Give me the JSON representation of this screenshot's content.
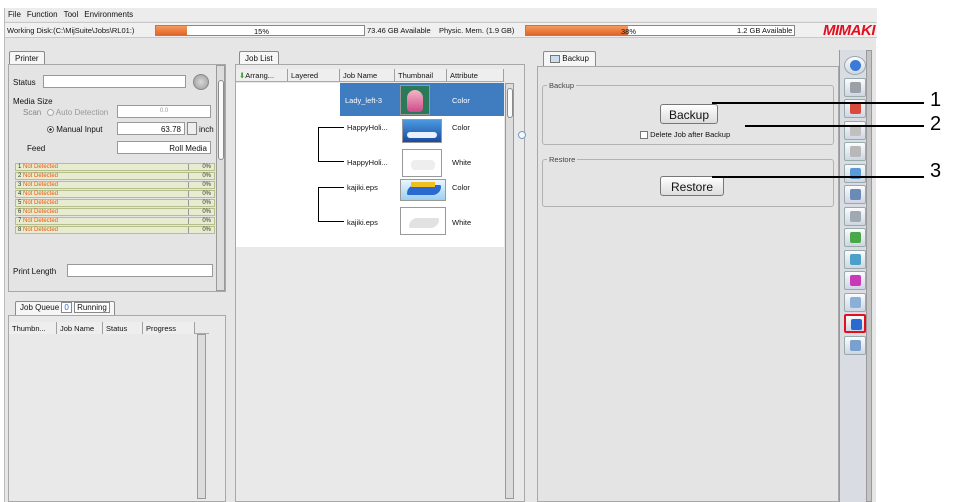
{
  "menu": [
    "File",
    "Function",
    "Tool",
    "Environments"
  ],
  "status": {
    "working_disk_label": "Working Disk:(C:\\MijSuite\\Jobs\\RL01:)",
    "disk_percent_text": "15%",
    "disk_fraction": 0.15,
    "disk_available": "73.46 GB Available",
    "mem_label": "Physic. Mem. (1.9 GB)",
    "mem_percent_text": "38%",
    "mem_fraction": 0.38,
    "mem_available": "1.2 GB Available",
    "logo": "MIMAKI",
    "accent_color": "#e0642a"
  },
  "printer": {
    "tab": "Printer",
    "status_label": "Status",
    "status_value": "",
    "media_size_label": "Media Size",
    "scan_label": "Scan",
    "auto_detection": "Auto Detection",
    "auto_value": "0.0",
    "manual_input": "Manual Input",
    "manual_value": "63.78",
    "unit": "inch",
    "feed_label": "Feed",
    "feed_value": "Roll Media",
    "print_length_label": "Print Length",
    "inks": [
      {
        "num": "1",
        "status": "Not Detected",
        "pct": "0%"
      },
      {
        "num": "2",
        "status": "Not Detected",
        "pct": "0%"
      },
      {
        "num": "3",
        "status": "Not Detected",
        "pct": "0%"
      },
      {
        "num": "4",
        "status": "Not Detected",
        "pct": "0%"
      },
      {
        "num": "5",
        "status": "Not Detected",
        "pct": "0%"
      },
      {
        "num": "6",
        "status": "Not Detected",
        "pct": "0%"
      },
      {
        "num": "7",
        "status": "Not Detected",
        "pct": "0%"
      },
      {
        "num": "8",
        "status": "Not Detected",
        "pct": "0%"
      }
    ]
  },
  "queue": {
    "tab_label": "Job Queue",
    "count": "0",
    "running_label": "Running",
    "columns": [
      "Thumbn...",
      "Job Name",
      "Status",
      "Progress"
    ]
  },
  "joblist": {
    "tab": "Job List",
    "columns": [
      "Arrang...",
      "Layered",
      "Job Name",
      "Thumbnail",
      "Attribute"
    ],
    "rows": [
      {
        "name": "Lady_left-3",
        "attr": "Color",
        "selected": true
      },
      {
        "name": "HappyHoli...",
        "attr": "Color"
      },
      {
        "name": "HappyHoli...",
        "attr": "White"
      },
      {
        "name": "kajiki.eps",
        "attr": "Color"
      },
      {
        "name": "kajiki.eps",
        "attr": "White"
      }
    ]
  },
  "backup": {
    "tab": "Backup",
    "group_backup": "Backup",
    "backup_button": "Backup",
    "delete_checkbox": "Delete Job after Backup",
    "group_restore": "Restore",
    "restore_button": "Restore"
  },
  "callouts": [
    "1",
    "2",
    "3"
  ],
  "toolbar_icons": [
    "info-icon",
    "layout-icon",
    "color-icon",
    "print-icon",
    "cut-icon",
    "copy-job-icon",
    "panel-icon",
    "layer-icon",
    "adjust-icon",
    "adjust2-icon",
    "color-wheel-icon",
    "duplicate-icon",
    "backup-icon",
    "trash-icon"
  ]
}
